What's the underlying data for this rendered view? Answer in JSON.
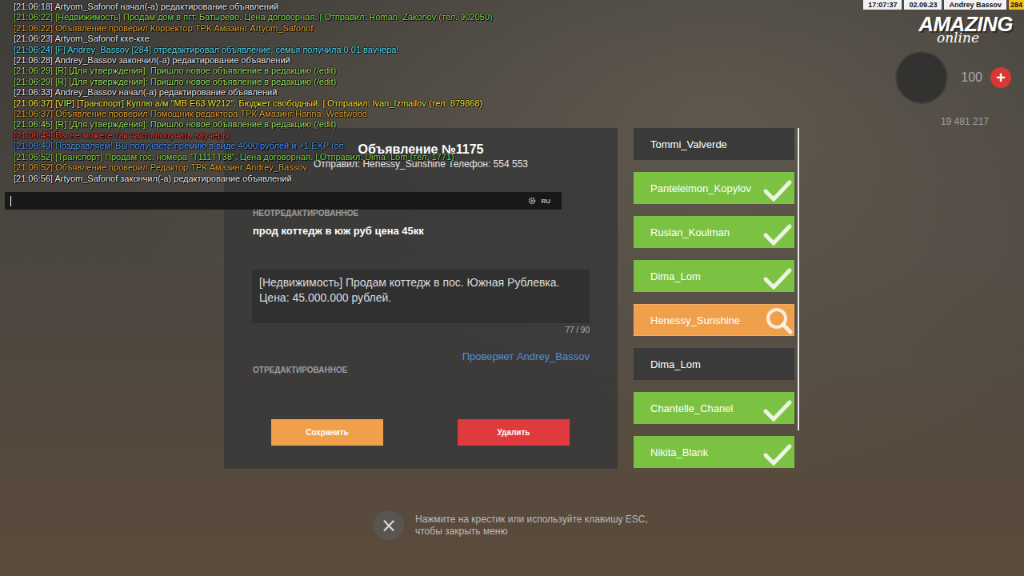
{
  "hud": {
    "time": "17:07:37",
    "date": "02.09.23",
    "player": "Andrey Bassov",
    "id": "284",
    "health": "100",
    "plus": "+",
    "money": "19 481 217"
  },
  "logo": {
    "title": "AMAZING",
    "subtitle": "online"
  },
  "chat": {
    "lines": [
      {
        "text": "[21:06:18] Artyom_Safonof начал(-а) редактирование объявлений",
        "color": "#e8e8e8"
      },
      {
        "text": "[21:06:22] [Недвижимость] Продам дом в пгт. Батырево. Цена договорная. | Отправил: Roman_Zakonov (тел. 902050)",
        "color": "#86d34f"
      },
      {
        "text": "[21:06:22] Объявление проверил Корректор ТРК Амазинг Artyom_Safonof",
        "color": "#d9a23a"
      },
      {
        "text": "[21:06:23] Artyom_Safonof кхе-кхе",
        "color": "#e8e8e8"
      },
      {
        "text": "[21:06:24] [F] Andrey_Bassov [284] отредактировал объявление, семья получила 0.01 ваучера!",
        "color": "#5ed8ec"
      },
      {
        "text": "[21:06:28] Andrey_Bassov закончил(-а) редактирование объявлений",
        "color": "#e8e8e8"
      },
      {
        "text": "[21:06:29] [R] [Для утверждения]: Пришло новое объявление в редакцию (/edit)",
        "color": "#9fdc6a"
      },
      {
        "text": "[21:06:29] [R] [Для утверждения]: Пришло новое объявление в редакцию (/edit)",
        "color": "#9fdc6a"
      },
      {
        "text": "[21:06:33] Andrey_Bassov начал(-а) редактирование объявлений",
        "color": "#e8e8e8"
      },
      {
        "text": "[21:06:37] [VIP] [Транспорт] Куплю а/м \"MB E63 W212\". Бюджет свободный. | Отправил: Ivan_Izmailov (тел. 879868)",
        "color": "#f3e23c"
      },
      {
        "text": "[21:06:37] Объявление проверил Помощник редактора ТРК Амазинг Hanna_Westwood",
        "color": "#d9a23a"
      },
      {
        "text": "[21:06:45] [R] [Для утверждения]: Пришло новое объявление в редакцию (/edit)",
        "color": "#9fdc6a"
      },
      {
        "text": "[21:06:49] Вы не можете так часто получать ваучеры",
        "color": "#e5413f"
      },
      {
        "text": "[21:06:49] Поздравляем! Вы получаете премию в виде 4000 рублей и +1 EXP (оп",
        "color": "#4f93ea"
      },
      {
        "text": "[21:06:52] [Транспорт] Продам гос. номера \"Т111ТТ38\". Цена договорная. | Отправил: Dima_Lom (тел. 1771)",
        "color": "#86d34f"
      },
      {
        "text": "[21:06:52] Объявление проверил Редактор ТРК Амазинг Andrey_Bassov",
        "color": "#d9a23a"
      },
      {
        "text": "[21:06:56] Artyom_Safonof закончил(-а) редактирование объявлений",
        "color": "#e8e8e8"
      }
    ]
  },
  "chat_input": {
    "value": "",
    "language": "RU"
  },
  "ad": {
    "title": "Объявление №1175",
    "sender": "Отправил: Henessy_Sunshine Телефон: 554 553",
    "raw_label": "НЕОТРЕДАКТИРОВАННОЕ",
    "raw_text": "прод коттедж в юж руб цена 45кк",
    "edited_text": "[Недвижимость] Продам коттедж в пос. Южная Рублевка.  Цена: 45.000.000 рублей.",
    "counter": "77 / 90",
    "checker": "Проверяет Andrey_Bassov",
    "edited_label": "ОТРЕДАКТИРОВАННОЕ",
    "buttons": [
      {
        "label": "Сохранить",
        "kind": "save"
      },
      {
        "label": "Удалить",
        "kind": "delete"
      }
    ]
  },
  "queue": {
    "items": [
      {
        "name": "Tommi_Valverde",
        "status": "new",
        "selected": false
      },
      {
        "name": "Panteleimon_Kopylov",
        "status": "done",
        "selected": false
      },
      {
        "name": "Ruslan_Koulman",
        "status": "done",
        "selected": false
      },
      {
        "name": "Dima_Lom",
        "status": "done",
        "selected": false
      },
      {
        "name": "Henessy_Sunshine",
        "status": "checking",
        "selected": true
      },
      {
        "name": "Dima_Lom",
        "status": "new",
        "selected": false
      },
      {
        "name": "Chantelle_Chanel",
        "status": "done",
        "selected": false
      },
      {
        "name": "Nikita_Blank",
        "status": "done",
        "selected": false
      }
    ]
  },
  "close": {
    "icon": "×",
    "hint_lines": [
      "Нажмите на крестик или используйте клавишу ESC,",
      "чтобы закрыть меню"
    ]
  }
}
